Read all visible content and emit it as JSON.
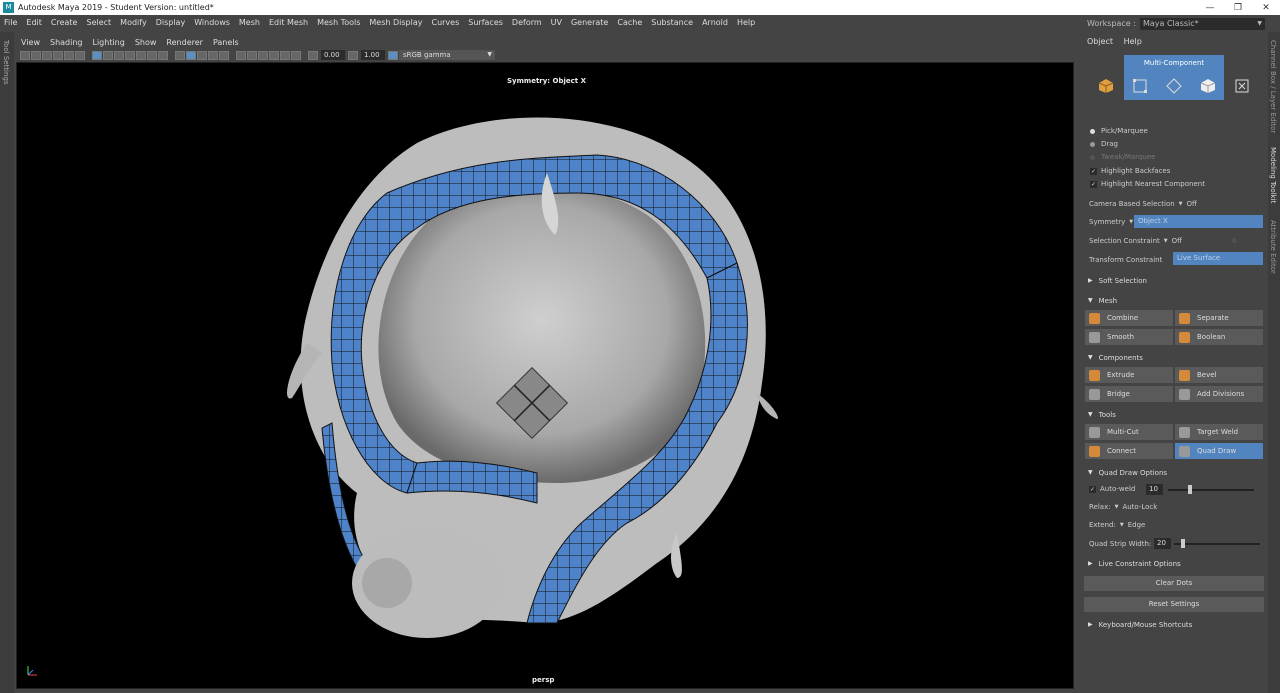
{
  "window": {
    "title": "Autodesk Maya 2019 - Student Version: untitled*"
  },
  "menubar": [
    "File",
    "Edit",
    "Create",
    "Select",
    "Modify",
    "Display",
    "Windows",
    "Mesh",
    "Edit Mesh",
    "Mesh Tools",
    "Mesh Display",
    "Curves",
    "Surfaces",
    "Deform",
    "UV",
    "Generate",
    "Cache",
    "Substance",
    "Arnold",
    "Help"
  ],
  "workspace": {
    "label": "Workspace :",
    "value": "Maya Classic*"
  },
  "left_tab": "Tool Settings",
  "viewport": {
    "menu": [
      "View",
      "Shading",
      "Lighting",
      "Show",
      "Renderer",
      "Panels"
    ],
    "exposure": "0.00",
    "gamma_value": "1.00",
    "colorspace": "sRGB gamma",
    "symmetry_label": "Symmetry: Object X",
    "camera": "persp"
  },
  "right_tabs": [
    "Channel Box / Layer Editor",
    "Modeling Toolkit",
    "Attribute Editor"
  ],
  "toolkit": {
    "menu": [
      "Object",
      "Help"
    ],
    "multi_component": "Multi-Component",
    "pick_marquee": "Pick/Marquee",
    "drag": "Drag",
    "tweak_marquee": "Tweak/Marquee",
    "highlight_backfaces": "Highlight Backfaces",
    "highlight_nearest": "Highlight Nearest Component",
    "camera_based_label": "Camera Based Selection",
    "camera_based_value": "Off",
    "symmetry_label": "Symmetry",
    "symmetry_value": "Object X",
    "sel_constraint_label": "Selection Constraint",
    "sel_constraint_value": "Off",
    "sel_constraint_num": "0",
    "transform_constraint_label": "Transform Constraint",
    "transform_constraint_value": "Live Surface",
    "soft_selection": "Soft Selection",
    "mesh_section": "Mesh",
    "combine": "Combine",
    "separate": "Separate",
    "smooth": "Smooth",
    "boolean": "Boolean",
    "components_section": "Components",
    "extrude": "Extrude",
    "bevel": "Bevel",
    "bridge": "Bridge",
    "add_divisions": "Add Divisions",
    "tools_section": "Tools",
    "multi_cut": "Multi-Cut",
    "target_weld": "Target Weld",
    "connect": "Connect",
    "quad_draw": "Quad Draw",
    "quad_draw_options": "Quad Draw Options",
    "auto_weld": "Auto-weld",
    "auto_weld_value": "10",
    "relax_label": "Relax:",
    "relax_value": "Auto-Lock",
    "extend_label": "Extend:",
    "extend_value": "Edge",
    "quad_strip_label": "Quad Strip Width:",
    "quad_strip_value": "20",
    "live_constraint": "Live Constraint Options",
    "clear_dots": "Clear Dots",
    "reset_settings": "Reset Settings",
    "keyboard_shortcuts": "Keyboard/Mouse Shortcuts",
    "accent_color": "#5285c0"
  }
}
